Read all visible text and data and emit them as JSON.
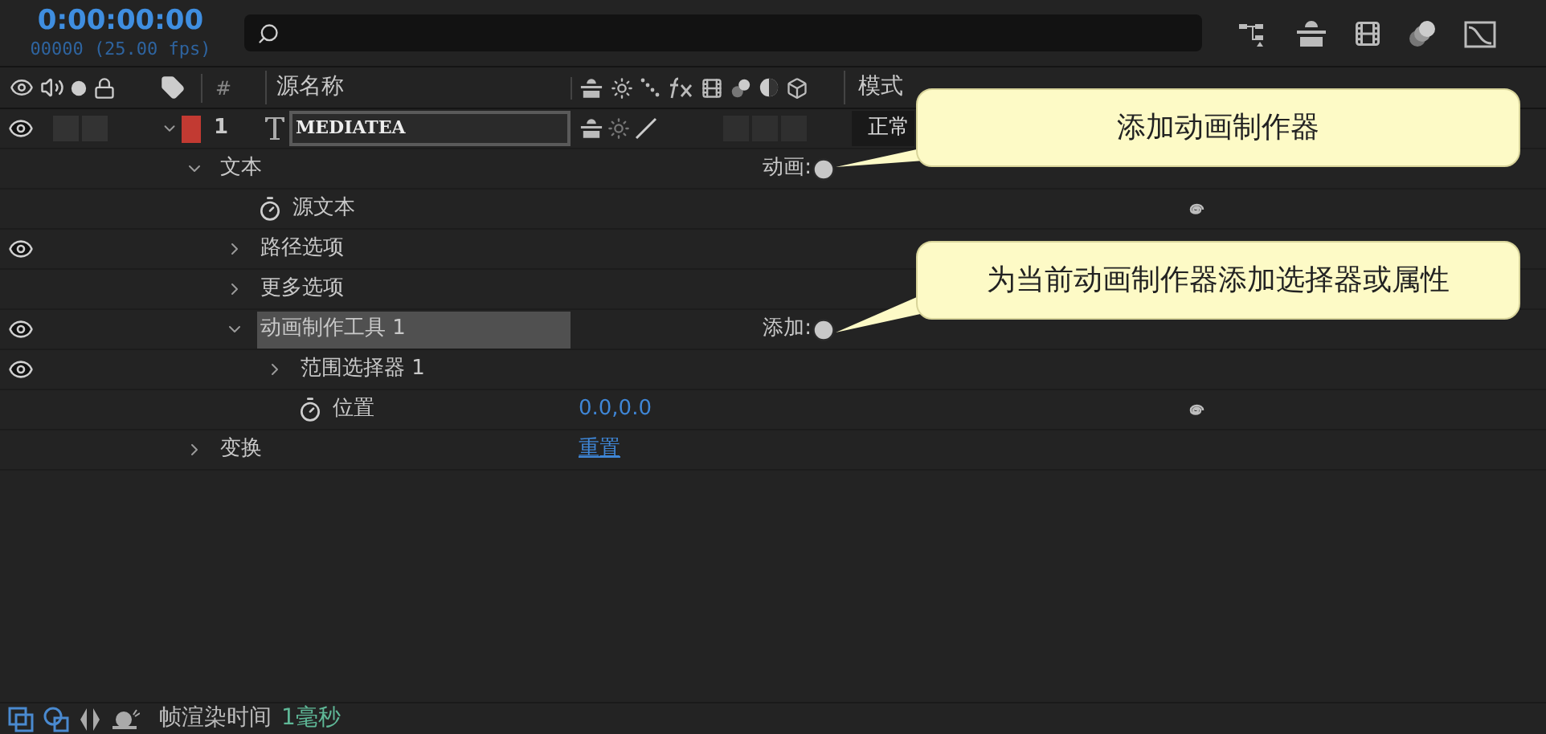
{
  "timecode": "0:00:00:00",
  "frame_info": "00000 (25.00 fps)",
  "header": {
    "number": "#",
    "source_name": "源名称",
    "mode": "模式"
  },
  "layer": {
    "number": "1",
    "name": "MEDIATEA",
    "visible": true,
    "expanded": true,
    "mode": "正常",
    "children": [
      {
        "name": "文本",
        "kind": "group",
        "expanded": true,
        "visible": false,
        "selected": false,
        "action": "动画:",
        "children": [
          {
            "name": "源文本",
            "kind": "property",
            "visible": false,
            "selected": false
          },
          {
            "name": "路径选项",
            "kind": "group",
            "expanded": false,
            "visible": true,
            "selected": false
          },
          {
            "name": "更多选项",
            "kind": "group",
            "expanded": false,
            "visible": false,
            "selected": false
          },
          {
            "name": "动画制作工具 1",
            "kind": "group",
            "expanded": true,
            "visible": true,
            "selected": true,
            "action": "添加:",
            "children": [
              {
                "name": "范围选择器 1",
                "kind": "group",
                "expanded": false,
                "visible": true,
                "selected": false
              },
              {
                "name": "位置",
                "kind": "property",
                "visible": false,
                "selected": false,
                "value": "0.0,0.0"
              }
            ]
          }
        ]
      },
      {
        "name": "变换",
        "kind": "group",
        "expanded": false,
        "visible": false,
        "selected": false,
        "link": "重置"
      }
    ]
  },
  "callouts": [
    {
      "text": "添加动画制作器"
    },
    {
      "text": "为当前动画制作器添加选择器或属性"
    }
  ],
  "status_bar": {
    "label": "帧渲染时间",
    "value": "1毫秒"
  }
}
